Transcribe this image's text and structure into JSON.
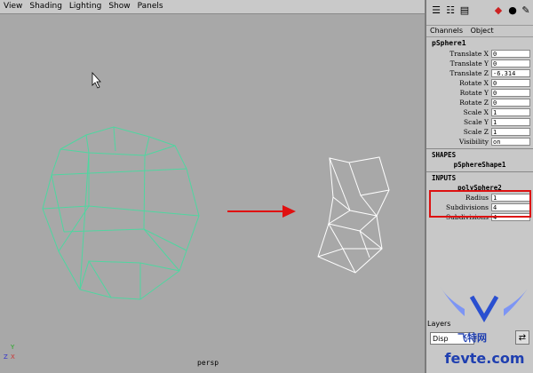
{
  "viewport": {
    "menu": [
      "View",
      "Shading",
      "Lighting",
      "Show",
      "Panels"
    ],
    "camera_label": "persp",
    "axis": {
      "x": "X",
      "y": "Y",
      "z": "Z"
    }
  },
  "channel_box": {
    "tabs": [
      "Channels",
      "Object"
    ],
    "object_name": "pSphere1",
    "attributes": [
      {
        "label": "Translate X",
        "value": "0"
      },
      {
        "label": "Translate Y",
        "value": "0"
      },
      {
        "label": "Translate Z",
        "value": "-6.314"
      },
      {
        "label": "Rotate X",
        "value": "0"
      },
      {
        "label": "Rotate Y",
        "value": "0"
      },
      {
        "label": "Rotate Z",
        "value": "0"
      },
      {
        "label": "Scale X",
        "value": "1"
      },
      {
        "label": "Scale Y",
        "value": "1"
      },
      {
        "label": "Scale Z",
        "value": "1"
      },
      {
        "label": "Visibility",
        "value": "on"
      }
    ],
    "shapes_header": "SHAPES",
    "shape_name": "pSphereShape1",
    "inputs_header": "INPUTS",
    "input_name": "polySphere2",
    "input_attrs": [
      {
        "label": "Radius",
        "value": "1"
      },
      {
        "label": "Subdivisions",
        "value": "4"
      },
      {
        "label": "Subdivisions",
        "value": "4"
      }
    ]
  },
  "layers": {
    "title": "Layers",
    "display": "Disp"
  },
  "watermark": {
    "cn": "飞特网",
    "en": "fevte.com"
  },
  "colors": {
    "wire_green": "#4fd6a0",
    "wire_white": "#ffffff",
    "arrow_red": "#e01010",
    "highlight_red": "#dd1111"
  }
}
